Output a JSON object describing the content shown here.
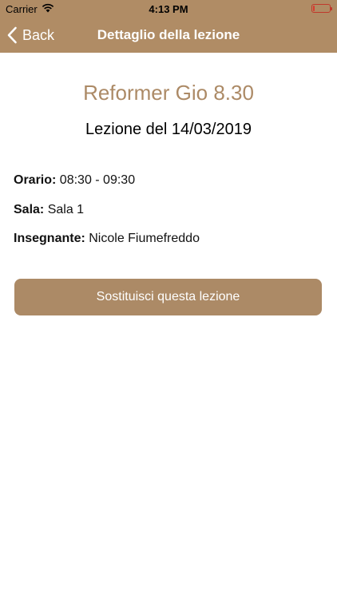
{
  "status_bar": {
    "carrier": "Carrier",
    "time": "4:13 PM",
    "battery_level": 0.1,
    "battery_color": "#d93a2f"
  },
  "nav": {
    "back_label": "Back",
    "title": "Dettaglio della lezione"
  },
  "lesson": {
    "course": "Reformer Gio 8.30",
    "date_line": "Lezione del 14/03/2019",
    "orario_label": "Orario:",
    "orario_value": "08:30 - 09:30",
    "sala_label": "Sala:",
    "sala_value": "Sala 1",
    "insegnante_label": "Insegnante:",
    "insegnante_value": "Nicole Fiumefreddo"
  },
  "actions": {
    "replace_label": "Sostituisci questa lezione"
  },
  "colors": {
    "accent": "#ac8a66",
    "header": "#b08c65"
  }
}
